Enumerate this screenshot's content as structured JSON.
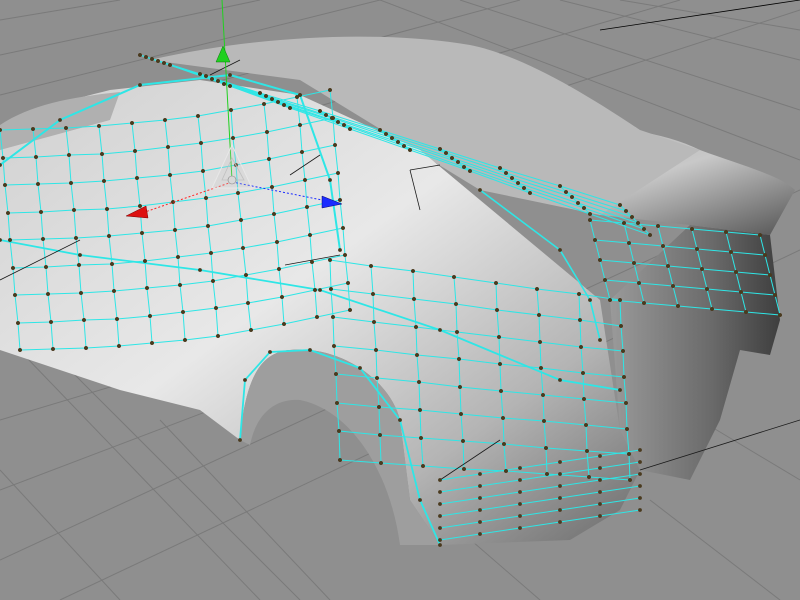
{
  "viewport": {
    "background_color": "#8f8f8f",
    "grid_line_color": "#7a7a7a",
    "grid_line_dark": "#000000",
    "wireframe_color": "#2ee6e6",
    "vertex_color": "#4a3a1e",
    "body_color_light": "#e4e4e4",
    "body_color_mid": "#b5b5b5",
    "body_color_dark": "#5a5a5a"
  },
  "gizmo": {
    "type": "translate",
    "x_axis_color": "#ff2020",
    "y_axis_color": "#20d020",
    "z_axis_color": "#1a2bff",
    "center_color": "#d8d8d8"
  },
  "model": {
    "name_icon": "car-body-mesh",
    "display_mode": "smooth-shaded-with-wireframe-on-shaded",
    "selection_state": "vertices-visible"
  }
}
